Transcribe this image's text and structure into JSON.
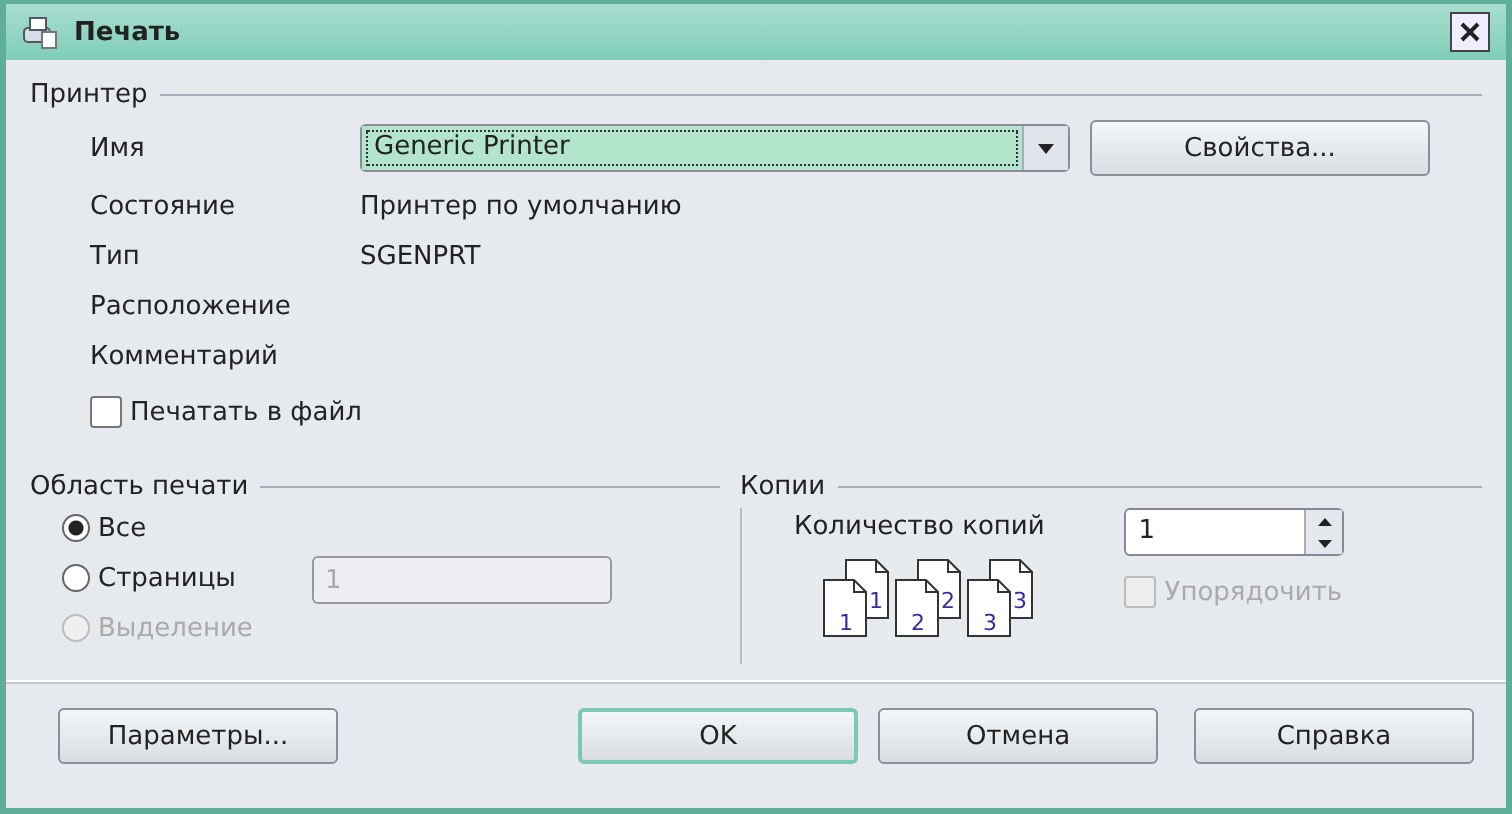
{
  "window": {
    "title": "Печать"
  },
  "printer": {
    "legend": "Принтер",
    "name_label": "Имя",
    "name_value": "Generic Printer",
    "properties_button": "Свойства...",
    "info": [
      {
        "label": "Состояние",
        "value": "Принтер по умолчанию"
      },
      {
        "label": "Тип",
        "value": "SGENPRT"
      },
      {
        "label": "Расположение"
      },
      {
        "label": "Комментарий"
      }
    ],
    "print_to_file": {
      "label": "Печатать в файл",
      "checked": false
    }
  },
  "range": {
    "legend": "Область печати",
    "options": [
      {
        "label": "Все",
        "selected": true,
        "disabled": false
      },
      {
        "label": "Страницы",
        "selected": false,
        "disabled": false
      },
      {
        "label": "Выделение",
        "selected": false,
        "disabled": true
      }
    ],
    "pages_field": {
      "placeholder": "1",
      "disabled": true
    }
  },
  "copies": {
    "legend": "Копии",
    "count_label": "Количество копий",
    "count_value": "1",
    "collate_pages": [
      {
        "back": "1",
        "front": "1"
      },
      {
        "back": "2",
        "front": "2"
      },
      {
        "back": "3",
        "front": "3"
      }
    ],
    "collate": {
      "label": "Упорядочить",
      "checked": false,
      "disabled": true
    }
  },
  "buttons": [
    {
      "label": "Параметры...",
      "default": false
    },
    {
      "label": "OK",
      "default": true
    },
    {
      "label": "Отмена",
      "default": false
    },
    {
      "label": "Справка",
      "default": false
    }
  ]
}
